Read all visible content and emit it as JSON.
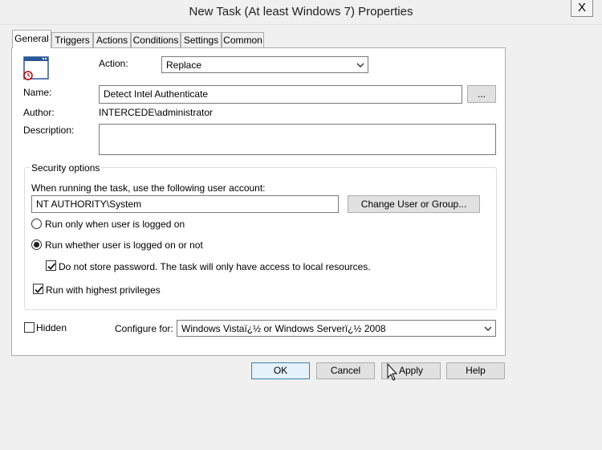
{
  "window": {
    "title": "New Task (At least Windows 7) Properties",
    "close_glyph": "X"
  },
  "tabs": [
    {
      "label": "General",
      "active": true
    },
    {
      "label": "Triggers",
      "active": false
    },
    {
      "label": "Actions",
      "active": false
    },
    {
      "label": "Conditions",
      "active": false
    },
    {
      "label": "Settings",
      "active": false
    },
    {
      "label": "Common",
      "active": false
    }
  ],
  "general": {
    "action_label": "Action:",
    "action_value": "Replace",
    "name_label": "Name:",
    "name_value": "Detect Intel Authenticate",
    "browse_label": "...",
    "author_label": "Author:",
    "author_value": "INTERCEDE\\administrator",
    "description_label": "Description:",
    "description_value": ""
  },
  "security": {
    "legend": "Security options",
    "account_prompt": "When running the task, use the following user account:",
    "account_value": "NT AUTHORITY\\System",
    "change_user_label": "Change User or Group...",
    "run_logged_on_label": "Run only when user is logged on",
    "run_logged_on_checked": false,
    "run_whether_label": "Run whether user is logged on or not",
    "run_whether_checked": true,
    "no_store_password_label": "Do not store password.  The task will only have access to local resources.",
    "no_store_password_checked": true,
    "highest_privileges_label": "Run with highest privileges",
    "highest_privileges_checked": true
  },
  "bottom": {
    "hidden_label": "Hidden",
    "hidden_checked": false,
    "configure_label": "Configure for:",
    "configure_value": "Windows Vistaï¿½ or Windows Serverï¿½ 2008"
  },
  "buttons": {
    "ok": "OK",
    "cancel": "Cancel",
    "apply": "Apply",
    "help": "Help"
  },
  "colors": {
    "accent_border": "#3c7fb1",
    "button_face": "#e1e1e1",
    "window_bg": "#f0f0f0"
  }
}
